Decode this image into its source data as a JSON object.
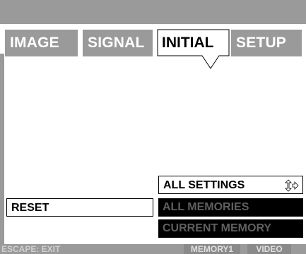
{
  "tabs": [
    {
      "label": "IMAGE",
      "active": false
    },
    {
      "label": "SIGNAL",
      "active": false
    },
    {
      "label": "INITIAL",
      "active": true
    },
    {
      "label": "SETUP",
      "active": false
    }
  ],
  "reset": {
    "label": "RESET"
  },
  "options": {
    "all_settings": "ALL SETTINGS",
    "all_memories": "ALL MEMORIES",
    "current_memory": "CURRENT MEMORY"
  },
  "status": {
    "escape_hint": "ESCAPE: EXIT",
    "memory": "MEMORY1",
    "source": "VIDEO"
  },
  "icons": {
    "spin": "updown-arrow-icon",
    "enter": "right-arrow-icon"
  },
  "colors": {
    "gray": "#9a9a9a",
    "dark": "#000000",
    "dim_text": "#5f5f5f"
  }
}
